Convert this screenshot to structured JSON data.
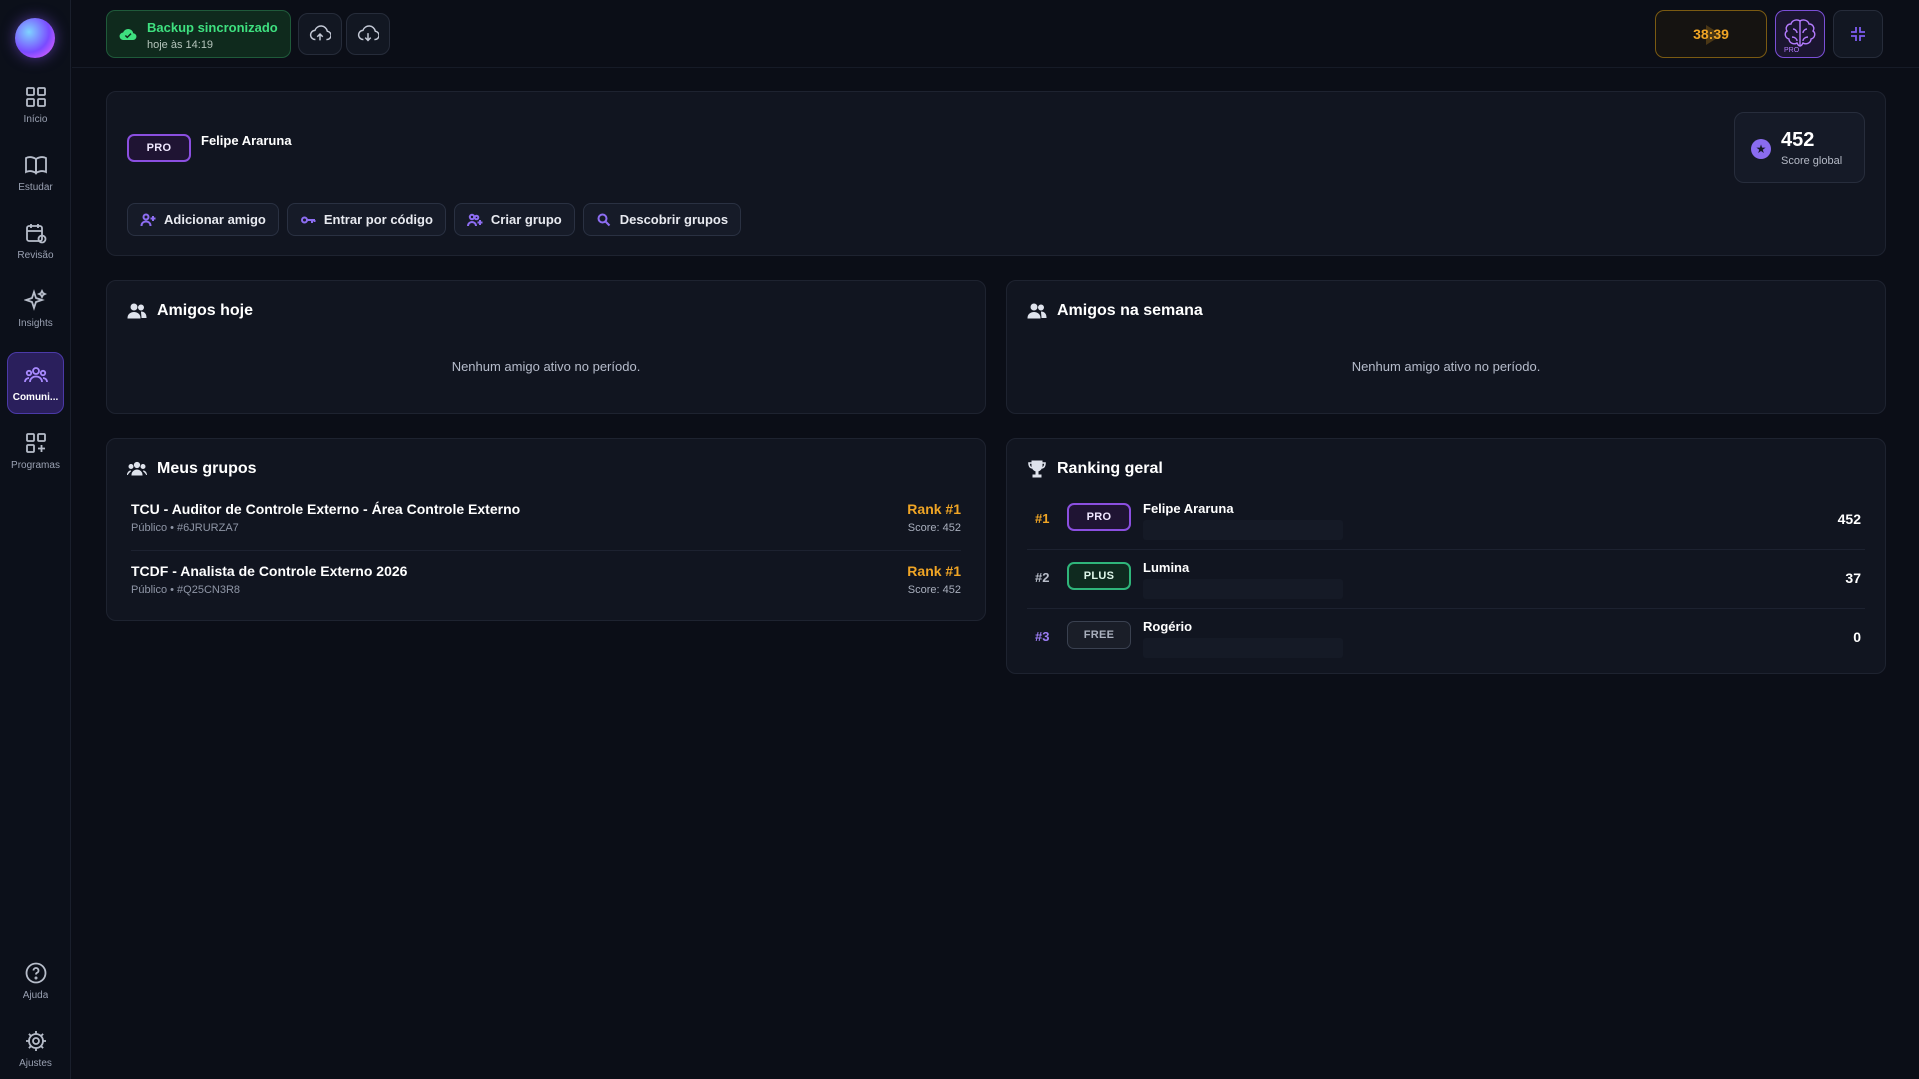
{
  "sidebar": {
    "items": [
      {
        "label": "Início",
        "icon": "grid-icon"
      },
      {
        "label": "Estudar",
        "icon": "book-icon"
      },
      {
        "label": "Revisão",
        "icon": "calendar-icon"
      },
      {
        "label": "Insights",
        "icon": "sparkles-icon"
      },
      {
        "label": "Comuni...",
        "icon": "community-icon",
        "active": true
      },
      {
        "label": "Programas",
        "icon": "grid-plus-icon"
      }
    ],
    "bottom": [
      {
        "label": "Ajuda",
        "icon": "help-icon"
      },
      {
        "label": "Ajustes",
        "icon": "gear-icon"
      }
    ]
  },
  "topbar": {
    "backup_title": "Backup sincronizado",
    "backup_sub": "hoje às 14:19",
    "timer": "38:39",
    "brain_badge": "PRO"
  },
  "profile": {
    "badge": "PRO",
    "name": "Felipe Araruna",
    "score_value": "452",
    "score_label": "Score global",
    "actions": [
      "Adicionar amigo",
      "Entrar por código",
      "Criar grupo",
      "Descobrir grupos"
    ]
  },
  "friends_today": {
    "title": "Amigos hoje",
    "empty": "Nenhum amigo ativo no período."
  },
  "friends_week": {
    "title": "Amigos na semana",
    "empty": "Nenhum amigo ativo no período."
  },
  "groups": {
    "title": "Meus grupos",
    "rows": [
      {
        "name": "TCU - Auditor de Controle Externo - Área Controle Externo",
        "meta": "Público • #6JRURZA7",
        "rank": "Rank #1",
        "score": "Score: 452"
      },
      {
        "name": "TCDF - Analista de Controle Externo 2026",
        "meta": "Público • #Q25CN3R8",
        "rank": "Rank #1",
        "score": "Score: 452"
      }
    ]
  },
  "ranking": {
    "title": "Ranking geral",
    "rows": [
      {
        "pos": "#1",
        "badge": "PRO",
        "name": "Felipe Araruna",
        "score": "452",
        "pos_color": "#f0a525"
      },
      {
        "pos": "#2",
        "badge": "PLUS",
        "name": "Lumina",
        "score": "37",
        "pos_color": "#b7bcc8"
      },
      {
        "pos": "#3",
        "badge": "FREE",
        "name": "Rogério",
        "score": "0",
        "pos_color": "#9b7cf2"
      }
    ]
  },
  "colors": {
    "accent": "#8b5cf6",
    "orange": "#f0a525",
    "green": "#3ee07f"
  }
}
